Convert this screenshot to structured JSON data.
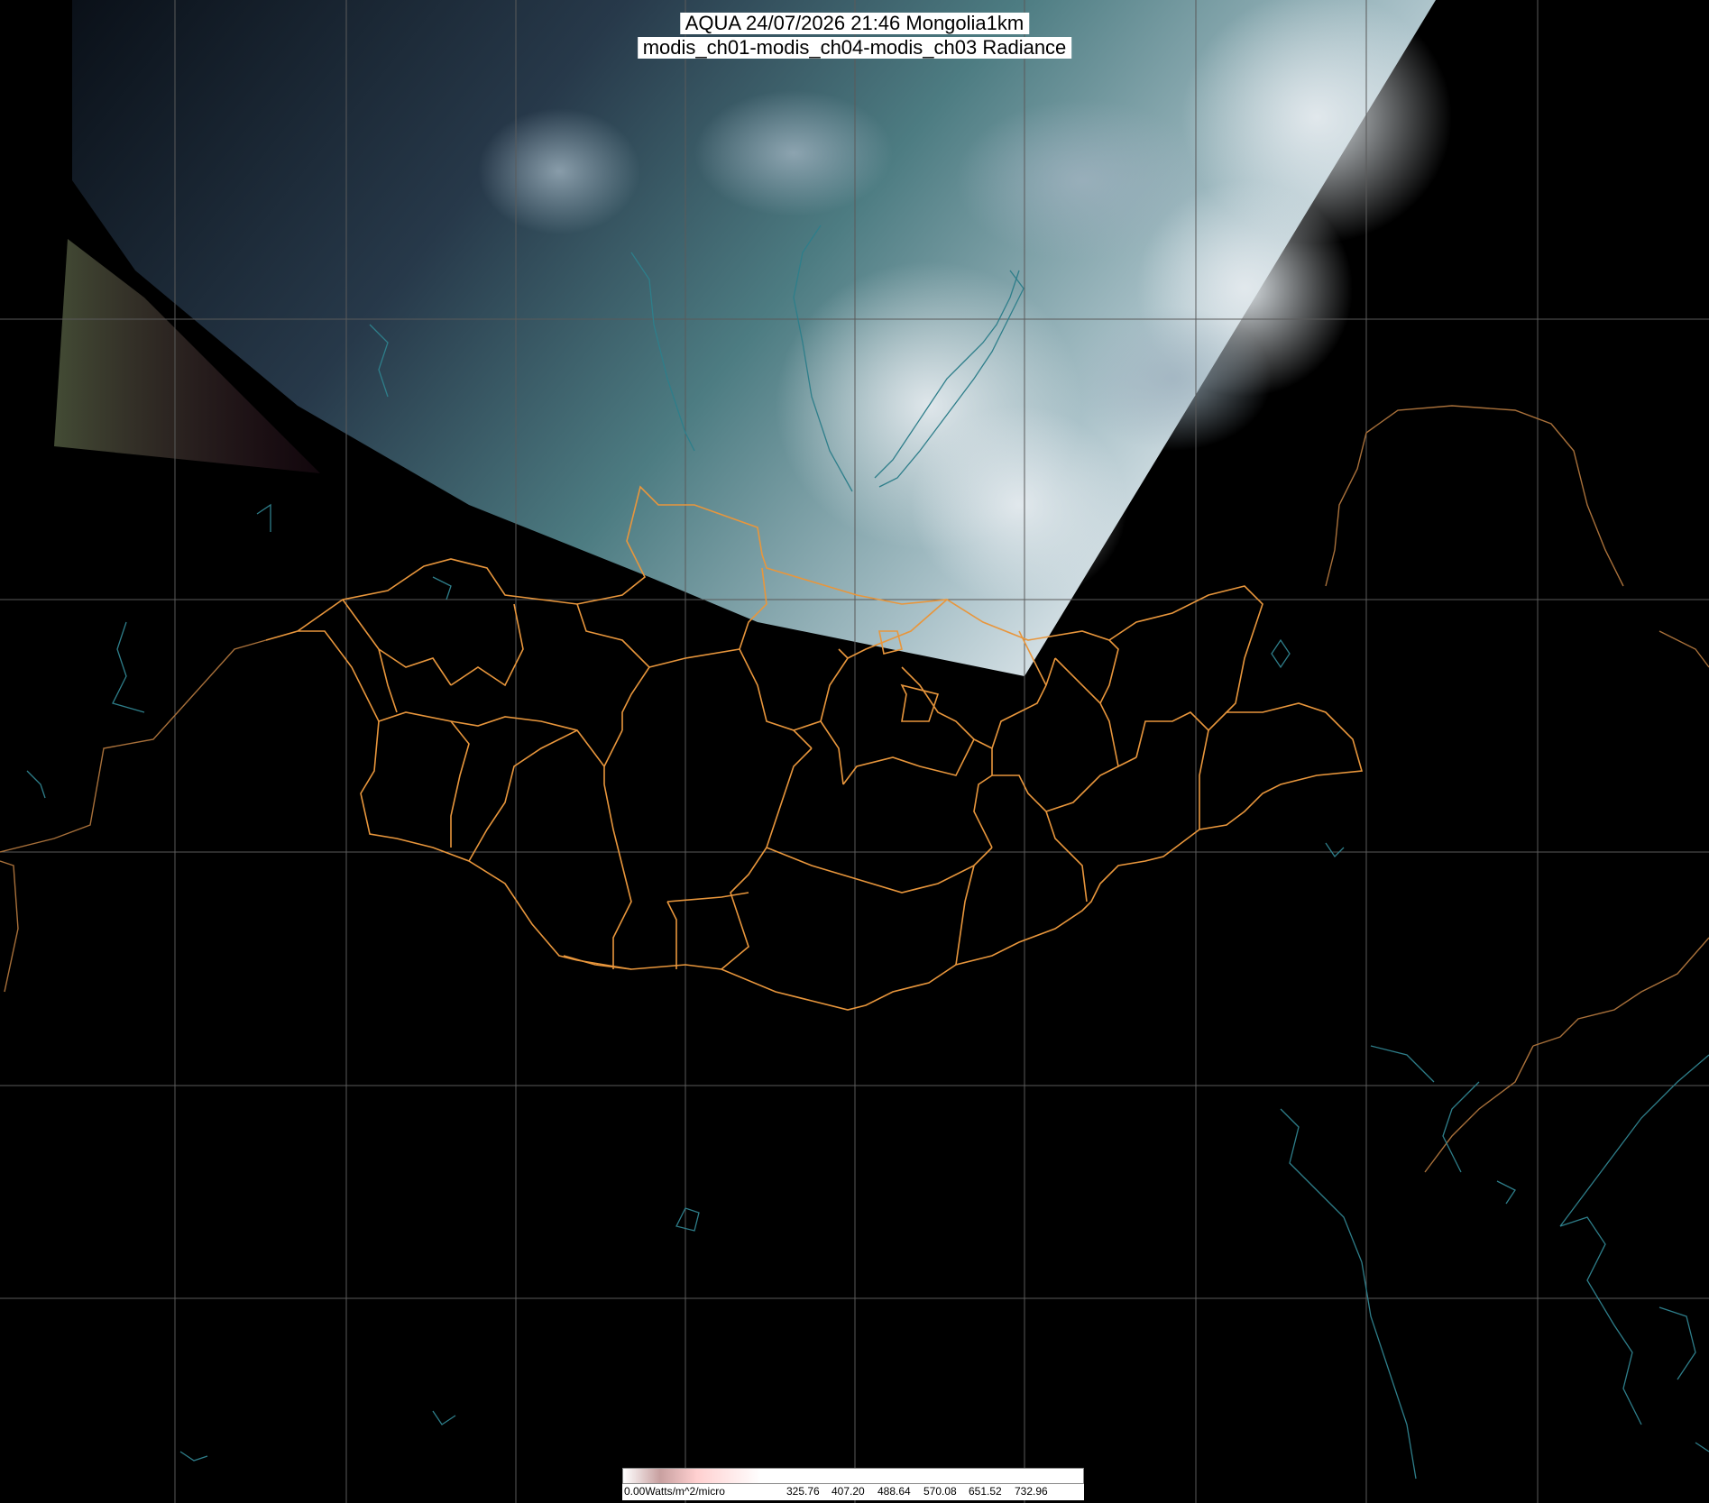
{
  "header": {
    "line1": "AQUA 24/07/2026 21:46 Mongolia1km",
    "line2": "modis_ch01-modis_ch04-modis_ch03 Radiance"
  },
  "colorbar": {
    "unit_label": "0.00Watts/m^2/micro",
    "ticks": [
      "325.76",
      "407.20",
      "488.64",
      "570.08",
      "651.52",
      "732.96"
    ],
    "colors": [
      "#ffffff",
      "#c8a0a0",
      "#ffd0d0",
      "#ffffff"
    ]
  },
  "colors": {
    "background": "#000000",
    "grid": "#5a5a5a",
    "admin_border": "#e8963c",
    "coastline_water": "#2e7e8a",
    "country_border": "#a8703a"
  }
}
